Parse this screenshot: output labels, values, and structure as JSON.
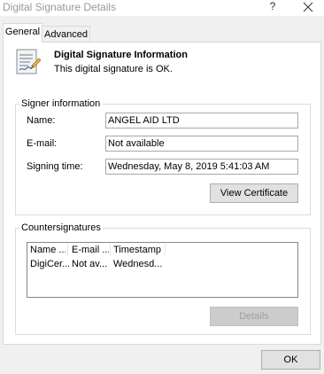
{
  "window": {
    "title": "Digital Signature Details",
    "help_glyph": "?",
    "close_icon": "close-icon"
  },
  "tabs": [
    {
      "label": "General",
      "selected": true
    },
    {
      "label": "Advanced",
      "selected": false
    }
  ],
  "info": {
    "icon": "certificate-signature-icon",
    "heading": "Digital Signature Information",
    "status": "This digital signature is OK."
  },
  "signer": {
    "legend": "Signer information",
    "name_label": "Name:",
    "name_value": "ANGEL AID LTD",
    "email_label": "E-mail:",
    "email_value": "Not available",
    "time_label": "Signing time:",
    "time_value": "Wednesday, May 8, 2019 5:41:03 AM",
    "view_cert_label": "View Certificate"
  },
  "countersignatures": {
    "legend": "Countersignatures",
    "columns": [
      "Name ...",
      "E-mail ...",
      "Timestamp"
    ],
    "rows": [
      [
        "DigiCer...",
        "Not av...",
        "Wednesd..."
      ]
    ],
    "details_label": "Details"
  },
  "footer": {
    "ok_label": "OK"
  },
  "colors": {
    "title_text": "#999999",
    "panel_bg": "#ffffff",
    "dialog_bg": "#f0f0f0",
    "button_bg": "#e1e1e1",
    "disabled_button_bg": "#cccccc"
  }
}
